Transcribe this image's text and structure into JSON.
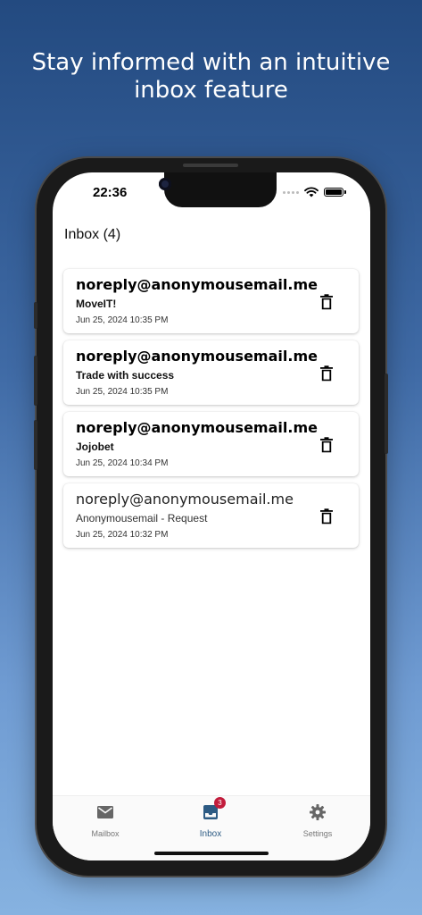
{
  "promo": {
    "headline_line1": "Stay informed with an intuitive",
    "headline_line2": "inbox feature"
  },
  "status_bar": {
    "time": "22:36",
    "icons": [
      "signal-dots-icon",
      "wifi-icon",
      "battery-icon"
    ]
  },
  "inbox": {
    "title": "Inbox (4)",
    "messages": [
      {
        "sender": "noreply@anonymousemail.me",
        "subject": "MoveIT!",
        "date": "Jun 25, 2024 10:35 PM",
        "unread": true
      },
      {
        "sender": "noreply@anonymousemail.me",
        "subject": "Trade with success",
        "date": "Jun 25, 2024 10:35 PM",
        "unread": true
      },
      {
        "sender": "noreply@anonymousemail.me",
        "subject": "Jojobet",
        "date": "Jun 25, 2024 10:34 PM",
        "unread": true
      },
      {
        "sender": "noreply@anonymousemail.me",
        "subject": "Anonymousemail - Request",
        "date": "Jun 25, 2024 10:32 PM",
        "unread": false
      }
    ],
    "delete_icon": "trash-icon"
  },
  "tabbar": {
    "tabs": [
      {
        "label": "Mailbox",
        "icon": "envelope-icon",
        "active": false
      },
      {
        "label": "Inbox",
        "icon": "inbox-tray-icon",
        "active": true,
        "badge": "3"
      },
      {
        "label": "Settings",
        "icon": "gear-icon",
        "active": false
      }
    ]
  },
  "colors": {
    "accent": "#2c5a83",
    "badge": "#c21c3c",
    "inactive_tab": "#777777",
    "background_top": "#234a80",
    "background_bottom": "#86b2e0"
  }
}
